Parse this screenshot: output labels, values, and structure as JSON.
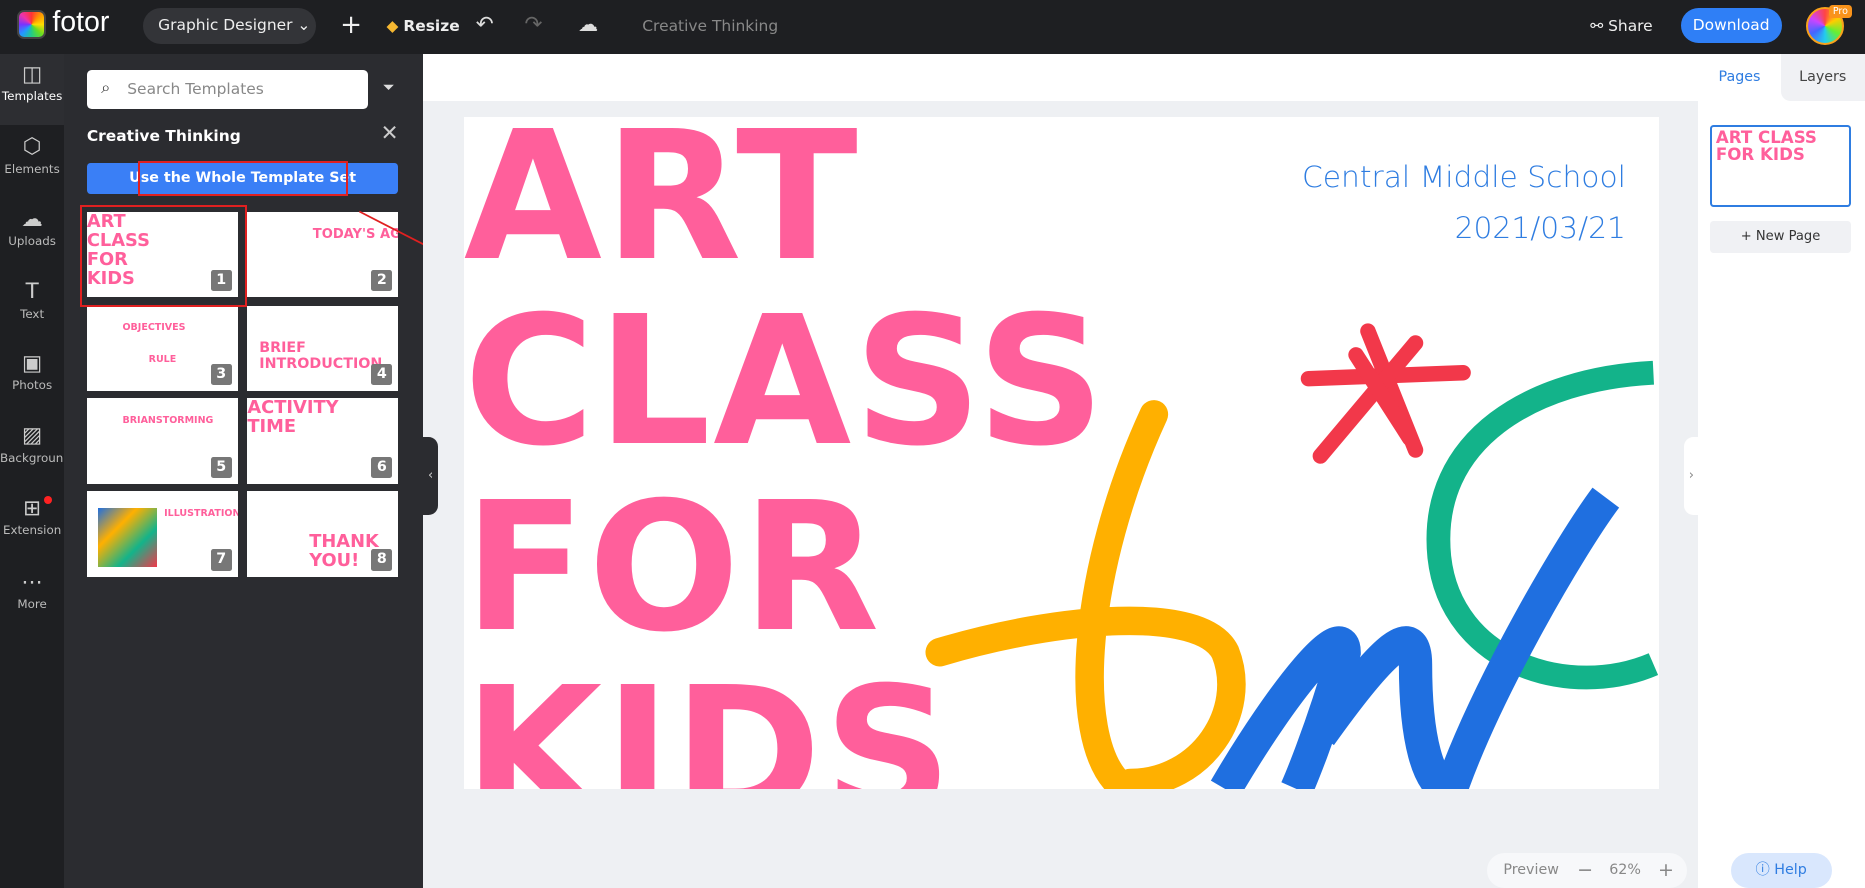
{
  "topbar": {
    "logo": "fotor",
    "mode": "Graphic Designer",
    "resize": "Resize",
    "doc_title": "Creative Thinking",
    "share": "Share",
    "download": "Download",
    "pro_badge": "Pro"
  },
  "nav": [
    {
      "label": "Templates",
      "icon": "template-icon"
    },
    {
      "label": "Elements",
      "icon": "shapes-icon"
    },
    {
      "label": "Uploads",
      "icon": "upload-cloud-icon"
    },
    {
      "label": "Text",
      "icon": "text-icon"
    },
    {
      "label": "Photos",
      "icon": "photo-icon"
    },
    {
      "label": "Backgroun...",
      "icon": "background-icon"
    },
    {
      "label": "Extension",
      "icon": "extension-icon"
    },
    {
      "label": "More",
      "icon": "more-icon"
    }
  ],
  "panel": {
    "search_placeholder": "Search Templates",
    "set_title": "Creative Thinking",
    "use_set": "Use the Whole Template Set",
    "thumbs": [
      {
        "title": "ART CLASS FOR KIDS",
        "num": "1"
      },
      {
        "title": "TODAY'S AGENDA",
        "num": "2"
      },
      {
        "title": "OBJECTIVES",
        "sub": "RULE",
        "num": "3"
      },
      {
        "title": "BRIEF INTRODUCTION",
        "num": "4"
      },
      {
        "title": "BRIANSTORMING",
        "num": "5"
      },
      {
        "title": "ACTIVITY TIME",
        "num": "6"
      },
      {
        "title": "ILLUSTRATIONS",
        "num": "7"
      },
      {
        "title": "THANK YOU!",
        "num": "8"
      }
    ]
  },
  "slide": {
    "lines": [
      "ART",
      "CLASS",
      "FOR",
      "KIDS"
    ],
    "school": "Central Middle School",
    "date": "2021/03/21"
  },
  "right": {
    "tab_pages": "Pages",
    "tab_layers": "Layers",
    "new_page": "+ New Page"
  },
  "bottom": {
    "preview": "Preview",
    "zoom": "62%",
    "help": "Help"
  },
  "colors": {
    "accent": "#3a7ff6",
    "pink": "#ff5f9b",
    "yellow": "#ffb000",
    "green": "#13b38a",
    "blue": "#1f6fe0",
    "red": "#f2384a"
  }
}
